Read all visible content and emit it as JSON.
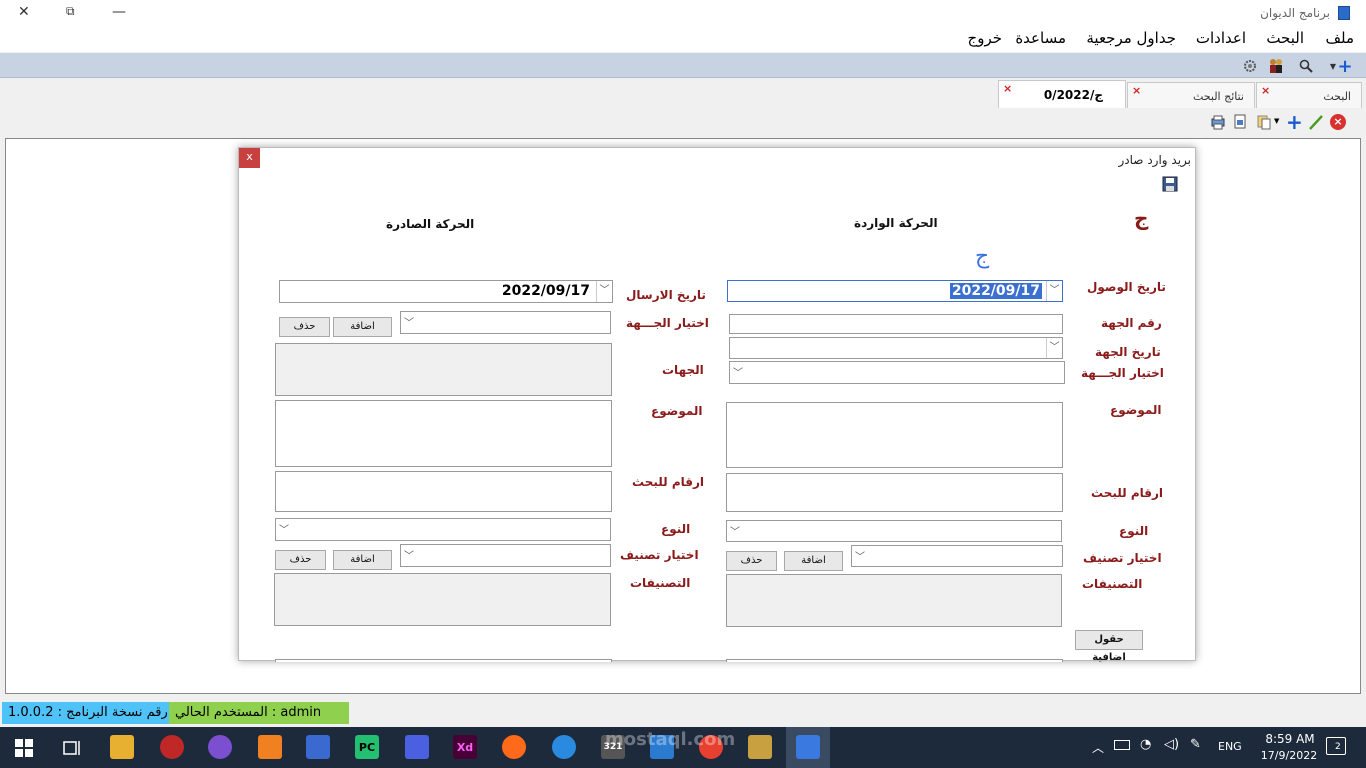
{
  "window": {
    "title": "برنامج الديوان",
    "min": "—",
    "restore": "⧉",
    "close": "✕"
  },
  "menu": {
    "items": [
      "ملف",
      "البحث",
      "اعدادات",
      "جداول مرجعية",
      "مساعدة",
      "خروج"
    ]
  },
  "tabs": [
    {
      "label": "البحث",
      "close": "×"
    },
    {
      "label": "نتائج البحث",
      "close": "×"
    },
    {
      "label": "0/ج/2022",
      "close": "×"
    }
  ],
  "dialog": {
    "title": "بريد وارد صادر",
    "close": "x",
    "code_letter": "ج",
    "blue_letter": "ج",
    "incoming": {
      "header": "الحركة الواردة",
      "arrival_date_label": "تاريخ الوصول",
      "arrival_date_value": "2022/09/17",
      "entity_number_label": "رقم الجهة",
      "entity_date_label": "تاريخ الجهة",
      "choose_entity_label": "اختيار الجـــهة",
      "subject_label": "الموضوع",
      "search_numbers_label": "ارقام للبحث",
      "type_label": "النوع",
      "choose_category_label": "اختيار تصنيف",
      "add_button": "اضافة",
      "delete_button": "حذف",
      "categories_label": "التصنيفات",
      "extra_fields_button": "حقول اضافية"
    },
    "outgoing": {
      "header": "الحركة الصادرة",
      "send_date_label": "تاريخ الارسال",
      "send_date_value": "2022/09/17",
      "choose_entity_label": "اختيار الجـــهة",
      "add_button": "اضافة",
      "delete_button": "حذف",
      "entities_label": "الجهات",
      "subject_label": "الموضوع",
      "search_numbers_label": "ارقام للبحث",
      "type_label": "النوع",
      "choose_category_label": "اختيار تصنيف",
      "add_button2": "اضافة",
      "delete_button2": "حذف",
      "categories_label": "التصنيفات"
    }
  },
  "status": {
    "version": "رقم نسخة البرنامج : 1.0.0.2",
    "user": "المستخدم الحالي : admin"
  },
  "taskbar": {
    "lang": "ENG",
    "time": "8:59 AM",
    "date": "17/9/2022",
    "notifications": "2",
    "watermark": "mostaql.com",
    "apps": [
      "PC",
      "Xd",
      "321"
    ]
  },
  "colors": {
    "toolbar": "#c7d3e3",
    "label": "#8b1a1a",
    "user_status": "#8fd14f",
    "version_status": "#4fc3f7",
    "taskbar": "#1d2a3c"
  }
}
